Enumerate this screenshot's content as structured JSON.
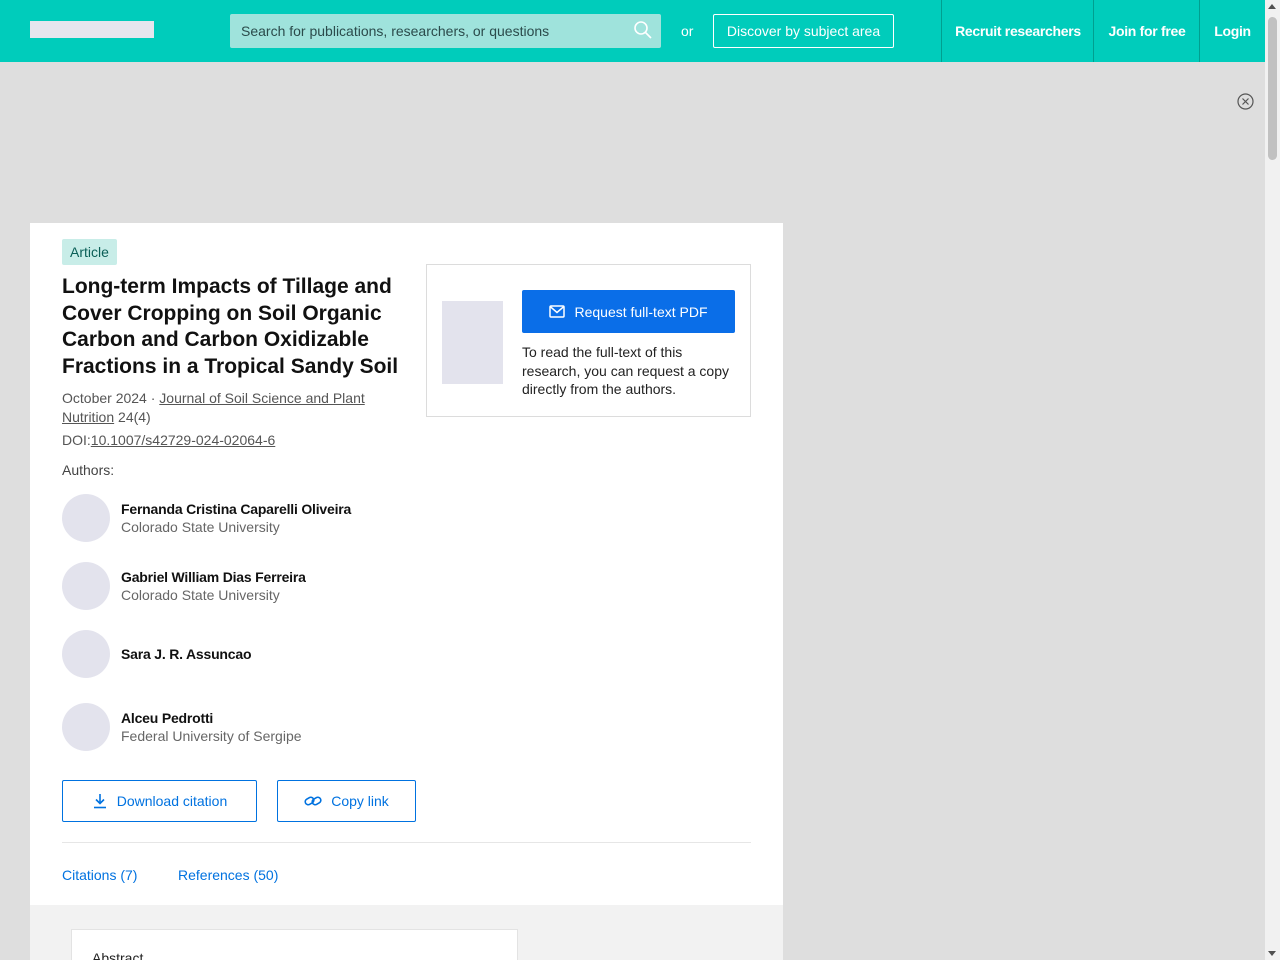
{
  "header": {
    "search_placeholder": "Search for publications, researchers, or questions",
    "or_text": "or",
    "discover_label": "Discover by subject area",
    "nav": [
      "Recruit researchers",
      "Join for free",
      "Login"
    ]
  },
  "article": {
    "badge": "Article",
    "title": "Long-term Impacts of Tillage and Cover Cropping on Soil Organic Carbon and Carbon Oxidizable Fractions in a Tropical Sandy Soil",
    "date": "October 2024 · ",
    "journal": "Journal of Soil Science and Plant Nutrition",
    "volume": " 24(4)",
    "doi_label": "DOI:",
    "doi": "10.1007/s42729-024-02064-6",
    "authors_label": "Authors:",
    "authors": [
      {
        "name": "Fernanda Cristina Caparelli Oliveira",
        "affiliation": "Colorado State University"
      },
      {
        "name": "Gabriel William Dias Ferreira",
        "affiliation": "Colorado State University"
      },
      {
        "name": "Sara J. R. Assuncao",
        "affiliation": ""
      },
      {
        "name": "Alceu Pedrotti",
        "affiliation": "Federal University of Sergipe"
      }
    ],
    "download_citation": "Download citation",
    "copy_link": "Copy link",
    "tabs": [
      "Citations (7)",
      "References (50)"
    ],
    "abstract_heading": "Abstract"
  },
  "request": {
    "button": "Request full-text PDF",
    "text": "To read the full-text of this research, you can request a copy directly from the authors."
  },
  "colors": {
    "brand": "#00ccbb",
    "primary": "#0a6ee8",
    "link": "#0072e0"
  }
}
